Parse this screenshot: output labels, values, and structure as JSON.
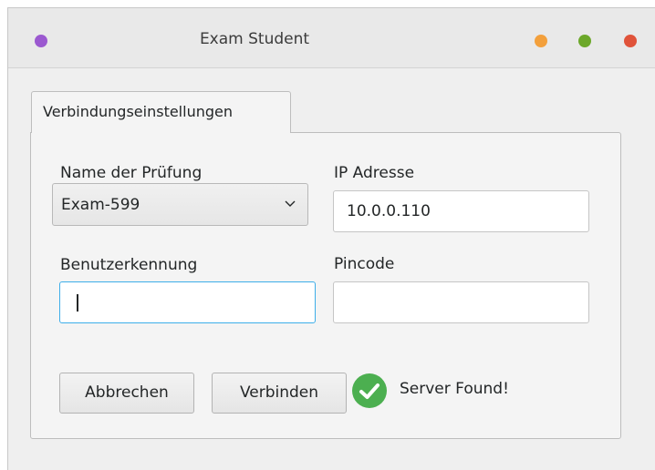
{
  "window": {
    "title": "Exam Student"
  },
  "tabs": [
    {
      "label": "Verbindungseinstellungen",
      "selected": true
    }
  ],
  "form": {
    "exam_name": {
      "label": "Name der Prüfung",
      "value": "Exam-599"
    },
    "ip_address": {
      "label": "IP Adresse",
      "value": "10.0.0.110"
    },
    "user_id": {
      "label": "Benutzerkennung",
      "value": ""
    },
    "pincode": {
      "label": "Pincode",
      "value": ""
    }
  },
  "buttons": {
    "cancel": "Abbrechen",
    "connect": "Verbinden"
  },
  "status": {
    "text": "Server Found!",
    "icon": "check-circle-icon",
    "color": "#4caf50"
  },
  "colors": {
    "focus": "#3daee9",
    "menu_dot": "#9b59d0",
    "minimize_dot": "#f3a03c",
    "maximize_dot": "#6ca82a",
    "close_dot": "#e0533a"
  }
}
